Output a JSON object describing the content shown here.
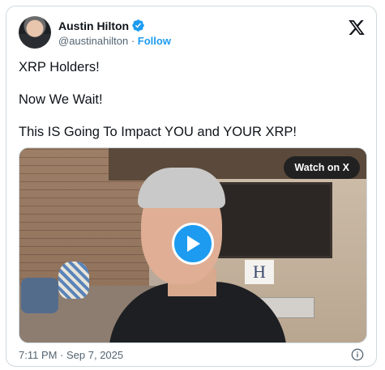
{
  "author": {
    "name": "Austin Hilton",
    "handle": "@austinahilton",
    "separator": "·",
    "follow_label": "Follow"
  },
  "tweet": {
    "lines": [
      "XRP Holders!",
      "Now We Wait!",
      "This IS Going To Impact YOU and YOUR XRP!"
    ]
  },
  "media": {
    "watch_label": "Watch on X",
    "sign_letter": "H"
  },
  "footer": {
    "timestamp": "7:11 PM · Sep 7, 2025"
  },
  "colors": {
    "accent": "#1d9bf0",
    "text": "#0f1419",
    "muted": "#536471",
    "border": "#cfd9de"
  },
  "icons": [
    "verified-badge-icon",
    "x-logo-icon",
    "play-icon",
    "info-icon"
  ]
}
